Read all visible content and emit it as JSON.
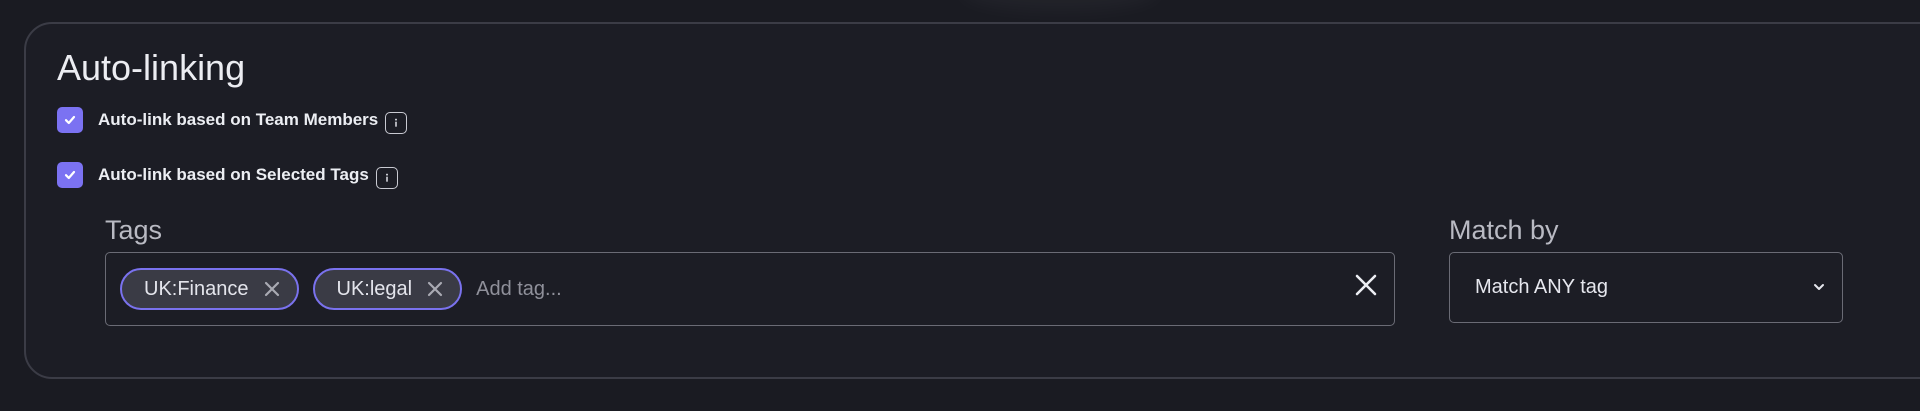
{
  "section": {
    "title": "Auto-linking"
  },
  "options": [
    {
      "label": "Auto-link based on Team Members",
      "checked": true,
      "info_icon": "info-icon"
    },
    {
      "label": "Auto-link based on Selected Tags",
      "checked": true,
      "info_icon": "info-icon"
    }
  ],
  "tags": {
    "label": "Tags",
    "chips": [
      {
        "label": "UK:Finance"
      },
      {
        "label": "UK:legal"
      }
    ],
    "placeholder": "Add tag...",
    "value": ""
  },
  "match_by": {
    "label": "Match by",
    "selected": "Match ANY tag"
  },
  "colors": {
    "background": "#1a1b22",
    "accent": "#7b72f2",
    "chip_background": "#3a3b45",
    "border": "#6a6b75",
    "muted_text": "#b9bac3"
  }
}
